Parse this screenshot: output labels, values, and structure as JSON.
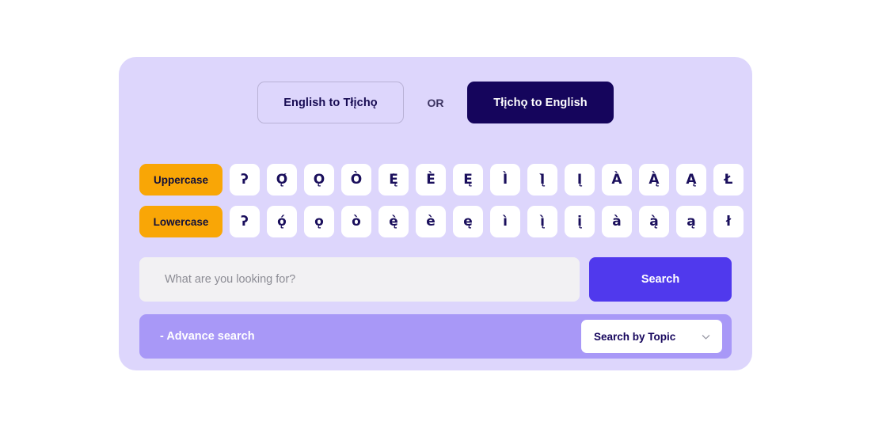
{
  "colors": {
    "card_bg": "#ddd6fc",
    "accent_dark": "#15055c",
    "accent_orange": "#f9a606",
    "accent_indigo": "#5039ed",
    "advance_bar": "#a898f7",
    "page_bg": "#ffffff"
  },
  "toggle": {
    "english_to_tlicho": "English to Tłįchǫ",
    "or": "OR",
    "tlicho_to_english": "Tłįchǫ to English",
    "selected": "Tłįchǫ to English"
  },
  "keyboard": {
    "uppercase_label": "Uppercase",
    "lowercase_label": "Lowercase",
    "uppercase_chars": [
      "ʔ",
      "Ǫ́",
      "Ǫ",
      "Ò",
      "Ę̀",
      "È",
      "Ę",
      "Ì",
      "Į̀",
      "Į",
      "À",
      "Ą̀",
      "Ą",
      "Ł"
    ],
    "lowercase_chars": [
      "ʔ",
      "ǫ́",
      "ǫ",
      "ò",
      "ę̀",
      "è",
      "ę",
      "ì",
      "į̀",
      "į",
      "à",
      "ą̀",
      "ą",
      "ł"
    ]
  },
  "search": {
    "placeholder": "What are you looking for?",
    "value": "",
    "button_label": "Search"
  },
  "advance": {
    "link_label": "- Advance search",
    "topic_label": "Search by Topic",
    "chevron_icon": "chevron-down-icon"
  }
}
